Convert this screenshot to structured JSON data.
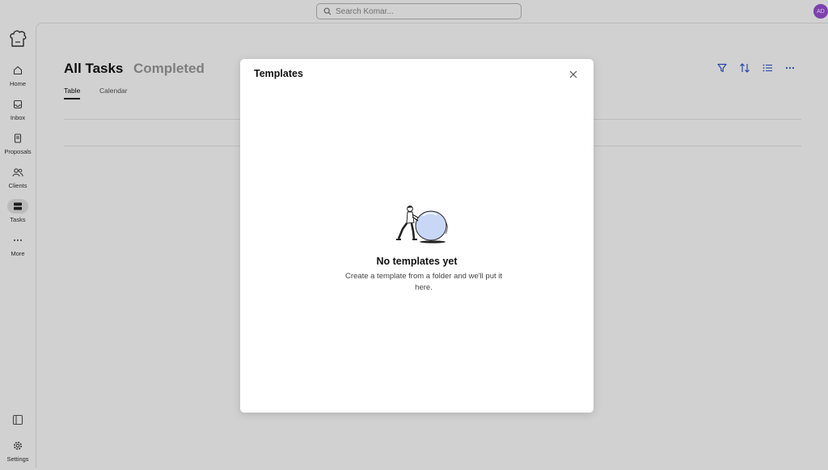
{
  "search": {
    "placeholder": "Search Komar..."
  },
  "user": {
    "initials": "AD",
    "avatar_color": "#9b4fd6"
  },
  "sidebar": {
    "items": [
      {
        "label": "Home",
        "icon": "home-icon"
      },
      {
        "label": "Inbox",
        "icon": "inbox-icon"
      },
      {
        "label": "Proposals",
        "icon": "proposals-icon"
      },
      {
        "label": "Clients",
        "icon": "clients-icon"
      },
      {
        "label": "Tasks",
        "icon": "tasks-icon",
        "active": true
      },
      {
        "label": "More",
        "icon": "more-icon"
      }
    ],
    "settings_label": "Settings"
  },
  "main": {
    "tabs": [
      {
        "label": "All Tasks",
        "active": true
      },
      {
        "label": "Completed",
        "active": false
      }
    ],
    "subtabs": [
      {
        "label": "Table",
        "active": true
      },
      {
        "label": "Calendar",
        "active": false
      }
    ],
    "toolbar_icons": [
      "filter-icon",
      "sort-icon",
      "list-icon",
      "more-horizontal-icon"
    ],
    "accent_color": "#2f55d4"
  },
  "modal": {
    "title": "Templates",
    "empty_title": "No templates yet",
    "empty_description": "Create a template from a folder and we'll put it here."
  }
}
